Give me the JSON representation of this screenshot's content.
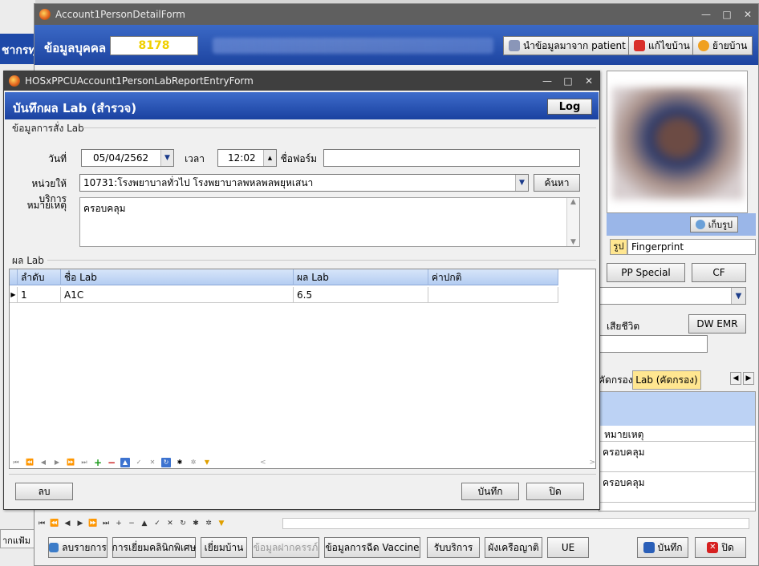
{
  "background_window": {
    "left_header_text": "ชากรทุ",
    "bottom_left_text": "ากแฟ้ม"
  },
  "detail_window": {
    "title": "Account1PersonDetailForm",
    "header_label": "ข้อมูลบุคคล",
    "hn_value": "8178",
    "btn_import_patient": "นำข้อมูลมาจาก patient",
    "btn_edit_house": "แก้ไขบ้าน",
    "btn_move_house": "ย้ายบ้าน",
    "btn_save_photo": "เก็บรูป",
    "tab_photo": "รูป",
    "tab_fingerprint": "Fingerprint",
    "btn_pp_special": "PP Special",
    "btn_cf": "CF",
    "label_dead": "เสียชีวิต",
    "btn_dw_emr": "DW EMR",
    "tab_screen_partial": "คัดกรอง",
    "tab_lab_screen": "Lab (คัดกรอง)",
    "right_grid": {
      "col_note": "หมายเหตุ",
      "rows": [
        "ครอบคลุม",
        "ครอบคลุม"
      ]
    },
    "bottom_buttons": {
      "list": "ลบรายการ",
      "clinic_visit": "การเยี่ยมคลินิกพิเศษ",
      "home_visit": "เยี่ยมบ้าน",
      "deposit": "ข้อมูลฝากครรภ์",
      "vaccine": "ข้อมูลการฉีด Vaccine",
      "service": "รับบริการ",
      "family_tree": "ผังเครือญาติ",
      "ue": "UE",
      "save": "บันทึก",
      "close": "ปิด"
    }
  },
  "lab_dialog": {
    "title": "HOSxPPCUAccount1PersonLabReportEntryForm",
    "header": "บันทึกผล Lab (สำรวจ)",
    "log_button": "Log",
    "group_order": "ข้อมูลการสั่ง Lab",
    "label_date": "วันที่",
    "date_value": "05/04/2562",
    "label_time": "เวลา",
    "time_value": "12:02",
    "label_form_name": "ชื่อฟอร์ม",
    "form_name_value": "",
    "label_unit": "หน่วยให้บริการ",
    "unit_value": "10731:โรงพยาบาลทั่วไป โรงพยาบาลพหลพลพยุหเสนา",
    "search_button": "ค้นหา",
    "label_note": "หมายเหตุ",
    "note_value": "ครอบคลุม",
    "group_result": "ผล Lab",
    "grid": {
      "columns": [
        "ลำดับ",
        "ชื่อ Lab",
        "ผล Lab",
        "ค่าปกติ"
      ],
      "rows": [
        {
          "no": "1",
          "name": "A1C",
          "result": "6.5",
          "normal": ""
        }
      ]
    },
    "delete_button": "ลบ",
    "save_button": "บันทึก",
    "close_button": "ปิด"
  },
  "colors": {
    "header_blue": "#1d44a0",
    "grid_header": "#b4cdf2",
    "tab_yellow": "#ffe690"
  }
}
